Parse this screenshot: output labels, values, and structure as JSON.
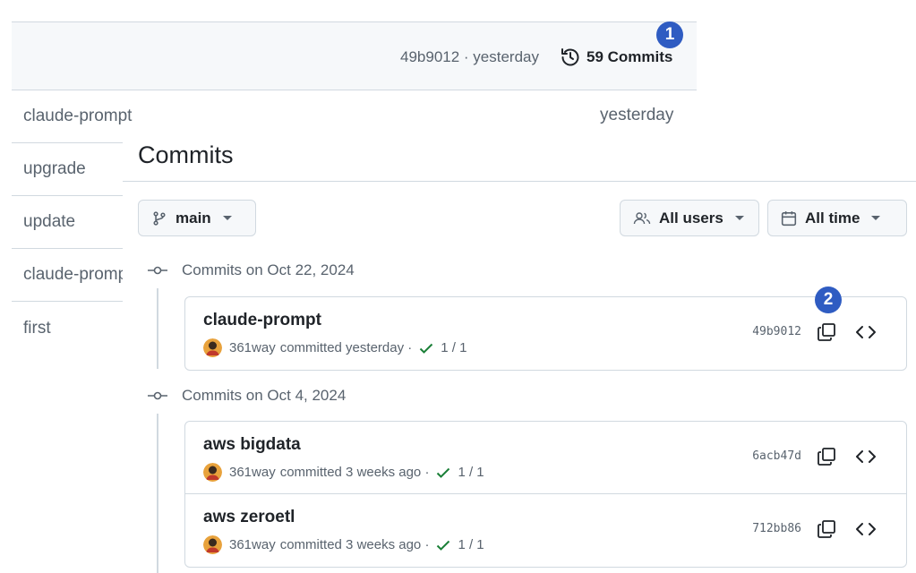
{
  "header": {
    "latest_commit": "49b9012 · yesterday",
    "commits_label": "59 Commits",
    "badge1": "1",
    "badge2": "2"
  },
  "files": [
    {
      "name": "claude-prompt"
    },
    {
      "name": "upgrade"
    },
    {
      "name": "update"
    },
    {
      "name": "claude-prompt"
    },
    {
      "name": "first"
    }
  ],
  "file_time": "yesterday",
  "page_title": "Commits",
  "filters": {
    "branch": "main",
    "users": "All users",
    "time": "All time"
  },
  "groups": [
    {
      "heading": "Commits on Oct 22, 2024",
      "commits": [
        {
          "title": "claude-prompt",
          "author": "361way",
          "meta": "committed yesterday ·",
          "checks": "1 / 1",
          "sha": "49b9012"
        }
      ]
    },
    {
      "heading": "Commits on Oct 4, 2024",
      "commits": [
        {
          "title": "aws bigdata",
          "author": "361way",
          "meta": "committed 3 weeks ago ·",
          "checks": "1 / 1",
          "sha": "6acb47d"
        },
        {
          "title": "aws zeroetl",
          "author": "361way",
          "meta": "committed 3 weeks ago ·",
          "checks": "1 / 1",
          "sha": "712bb86"
        }
      ]
    }
  ],
  "colors": {
    "accent_badge": "#2f5cc2",
    "check_green": "#1a7f37",
    "border": "#d1d9e0"
  }
}
